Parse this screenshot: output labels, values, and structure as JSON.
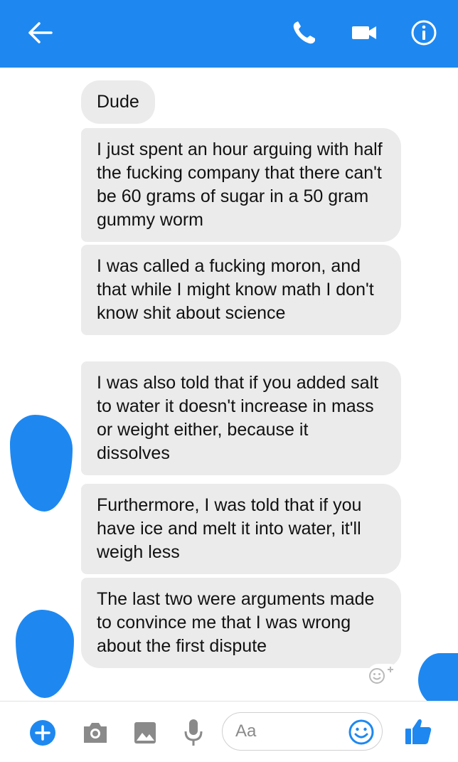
{
  "colors": {
    "accent": "#1e88f0",
    "bubble": "#ebebeb",
    "text": "#111111"
  },
  "header": {
    "icons": [
      "arrow-left-icon",
      "phone-icon",
      "video-camera-icon",
      "info-icon"
    ]
  },
  "messages": [
    {
      "text": "Dude"
    },
    {
      "text": "I just spent an hour arguing with half the fucking company that there can't be 60 grams of sugar in a 50 gram gummy worm"
    },
    {
      "text": "I was called a fucking moron, and that while I might know math I don't know shit about science"
    },
    {
      "text": "I was also told that if you added salt to water it doesn't increase in mass or weight either, because it dissolves"
    },
    {
      "text": "Furthermore, I was told that if you have ice and melt it into water, it'll weigh less"
    },
    {
      "text": "The last two were arguments made to convince me that I was wrong about the first dispute"
    }
  ],
  "composer": {
    "placeholder": "Aa",
    "icons": [
      "plus-icon",
      "camera-icon",
      "image-icon",
      "microphone-icon",
      "emoji-icon",
      "thumbs-up-icon"
    ]
  }
}
